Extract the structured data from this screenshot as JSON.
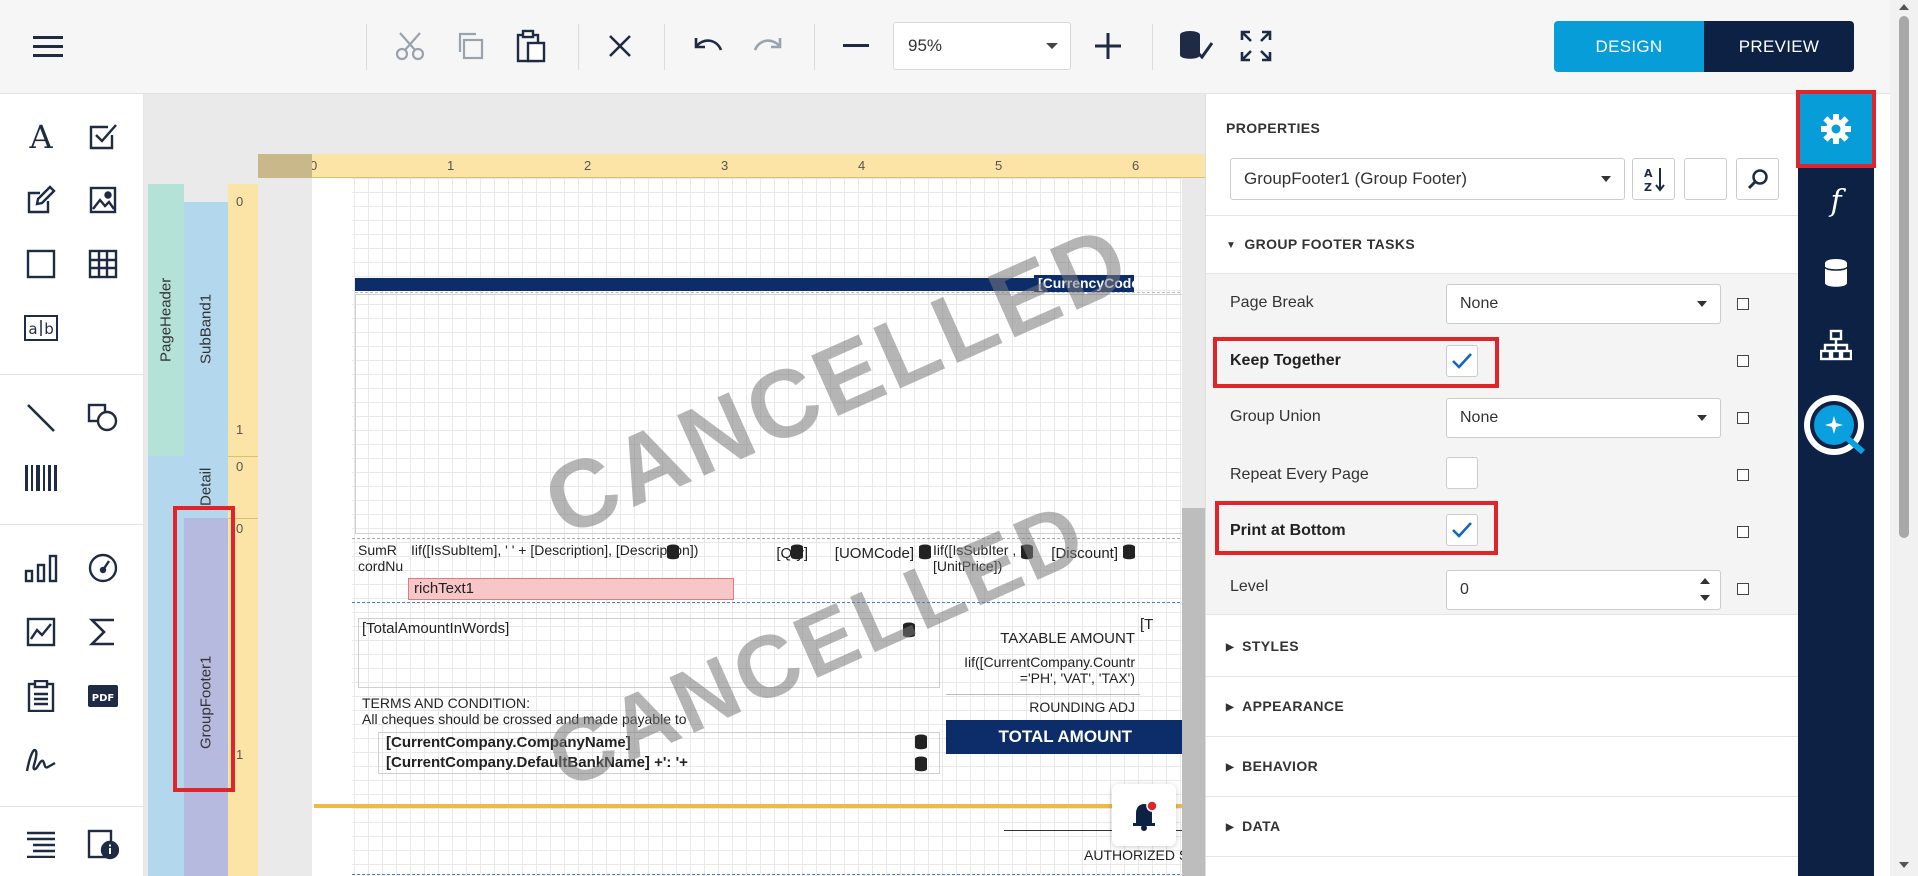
{
  "toolbar": {
    "zoom_value": "95%",
    "design_label": "DESIGN",
    "preview_label": "PREVIEW"
  },
  "toolbox": {
    "label_tool": "ab"
  },
  "surface": {
    "ruler_numbers": [
      "0",
      "1",
      "2",
      "3",
      "4",
      "5",
      "6"
    ],
    "vruler_numbers": [
      "0",
      "1",
      "0",
      "0",
      "1"
    ],
    "bands": {
      "page_header": "PageHeader",
      "sub_band": "SubBand1",
      "detail": "Detail",
      "group_footer": "GroupFooter1"
    },
    "fields": {
      "currency_code": "[CurrencyCode",
      "sum_record": "SumR cordNu",
      "description": "Iif([IsSubItem], '   ' + [Description], [Description])",
      "qty": "[Qty]",
      "uom": "[UOMCode]",
      "unit_price": "Iif([IsSubIter , '', [UnitPrice])",
      "discount": "[Discount]",
      "rich_text": "richText1",
      "amount_words": "[TotalAmountInWords]",
      "taxable": "TAXABLE AMOUNT",
      "tax_expr": "Iif([CurrentCompany.Countr ='PH', 'VAT', 'TAX')",
      "rounding": "ROUNDING ADJ",
      "total": "TOTAL AMOUNT",
      "terms_title": "TERMS AND CONDITION:",
      "terms_text": "All cheques should be crossed and made payable to",
      "company_name": "[CurrentCompany.CompanyName]",
      "bank_name": "[CurrentCompany.DefaultBankName] +': '+",
      "authorized": "AUTHORIZED S",
      "t_bracket": "[T"
    },
    "watermark": "CANCELLED"
  },
  "properties": {
    "title": "PROPERTIES",
    "selected_object": "GroupFooter1 (Group Footer)",
    "tasks_title": "GROUP FOOTER TASKS",
    "rows": {
      "page_break": {
        "label": "Page Break",
        "value": "None"
      },
      "keep_together": {
        "label": "Keep Together",
        "checked": true
      },
      "group_union": {
        "label": "Group Union",
        "value": "None"
      },
      "repeat_every_page": {
        "label": "Repeat Every Page",
        "checked": false
      },
      "print_at_bottom": {
        "label": "Print at Bottom",
        "checked": true
      },
      "level": {
        "label": "Level",
        "value": "0"
      }
    },
    "sections": {
      "styles": "STYLES",
      "appearance": "APPEARANCE",
      "behavior": "BEHAVIOR",
      "data": "DATA"
    }
  },
  "colors": {
    "accent": "#069dd9",
    "navy": "#0c2144",
    "highlight": "#e0242a"
  }
}
